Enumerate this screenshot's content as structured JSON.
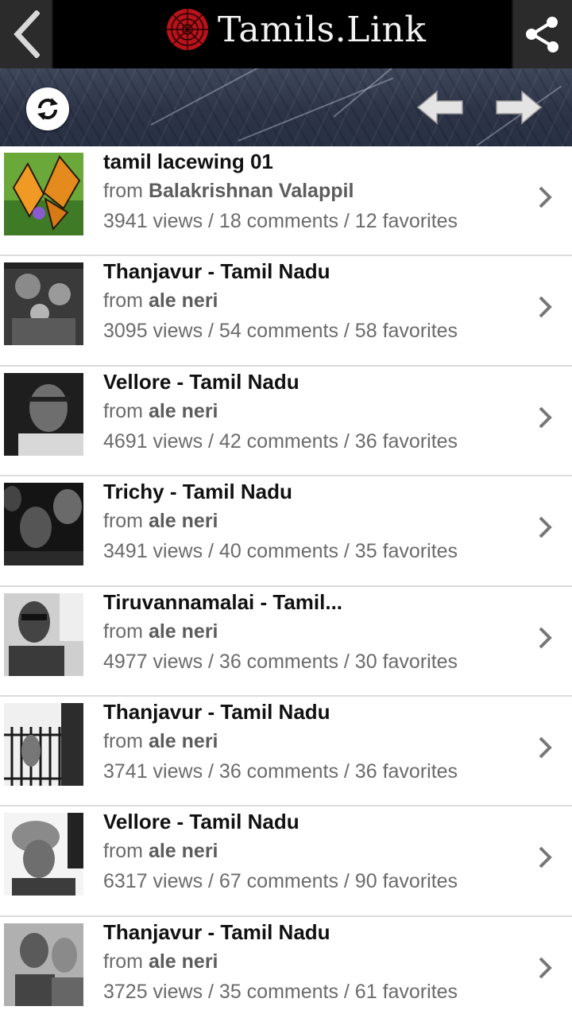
{
  "header": {
    "title": "Tamils.Link",
    "back_icon": "chevron-left-icon",
    "share_icon": "share-icon",
    "logo_icon": "red-flower-logo"
  },
  "toolbar": {
    "refresh_icon": "refresh-icon",
    "prev_icon": "arrow-left-icon",
    "next_icon": "arrow-right-icon"
  },
  "items": [
    {
      "title": "tamil lacewing 01",
      "from_prefix": "from",
      "author": "Balakrishnan Valappil",
      "stats": "3941 views / 18 comments / 12 favorites",
      "thumb": "butterfly-photo"
    },
    {
      "title": "Thanjavur - Tamil Nadu",
      "from_prefix": "from",
      "author": "ale neri",
      "stats": "3095 views / 54 comments / 58 favorites",
      "thumb": "family-photo"
    },
    {
      "title": "Vellore - Tamil Nadu",
      "from_prefix": "from",
      "author": "ale neri",
      "stats": "4691 views / 42 comments / 36 favorites",
      "thumb": "man-portrait-photo"
    },
    {
      "title": "Trichy - Tamil Nadu",
      "from_prefix": "from",
      "author": "ale neri",
      "stats": "3491 views / 40 comments / 35 favorites",
      "thumb": "boys-group-photo"
    },
    {
      "title": "Tiruvannamalai - Tamil...",
      "from_prefix": "from",
      "author": "ale neri",
      "stats": "4977 views / 36 comments / 30 favorites",
      "thumb": "street-man-photo"
    },
    {
      "title": "Thanjavur - Tamil Nadu",
      "from_prefix": "from",
      "author": "ale neri",
      "stats": "3741 views / 36 comments / 36 favorites",
      "thumb": "gate-child-photo"
    },
    {
      "title": "Vellore - Tamil Nadu",
      "from_prefix": "from",
      "author": "ale neri",
      "stats": "6317 views / 67 comments / 90 favorites",
      "thumb": "elderly-woman-photo"
    },
    {
      "title": "Thanjavur - Tamil Nadu",
      "from_prefix": "from",
      "author": "ale neri",
      "stats": "3725 views / 35 comments / 61 favorites",
      "thumb": "girls-portrait-photo"
    }
  ],
  "colors": {
    "header_bg": "#000000",
    "accent_logo": "#c8141a",
    "title_text": "#111111",
    "meta_text": "#6b6b6b"
  }
}
